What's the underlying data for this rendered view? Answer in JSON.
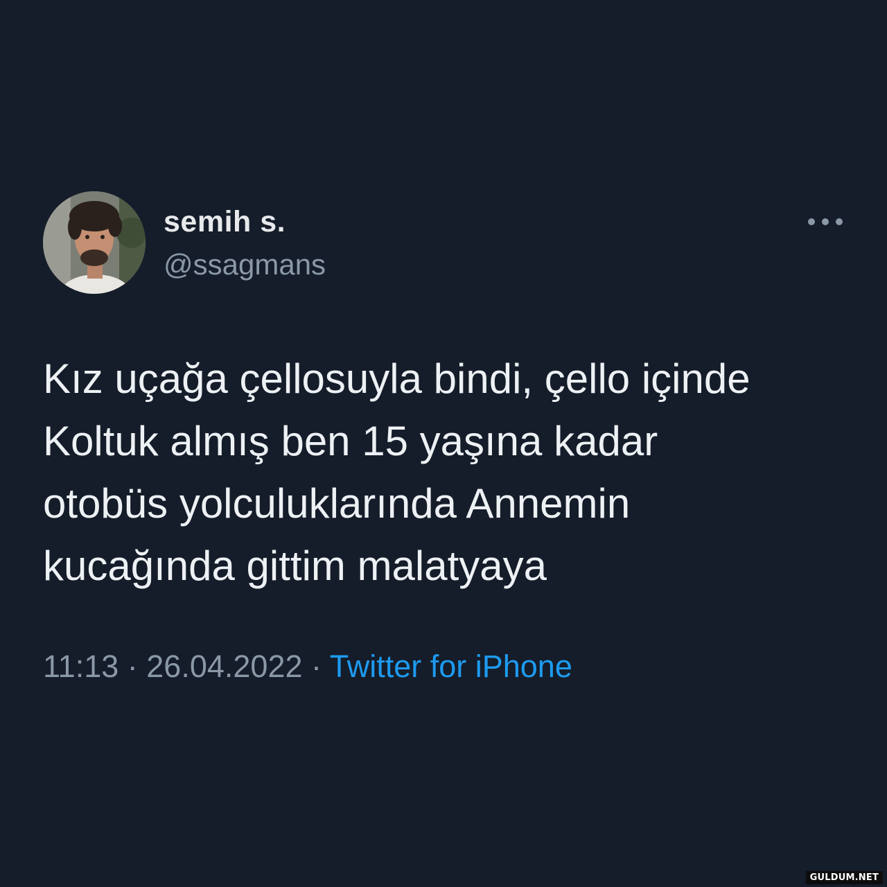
{
  "user": {
    "display_name": "semih s.",
    "handle": "@ssagmans"
  },
  "more_icon": "more-horizontal-icon",
  "tweet": {
    "lines": [
      "Kız uçağa çellosuyla bindi, çello içinde",
      "Koltuk almış ben 15 yaşına kadar",
      "otobüs yolculuklarında Annemin",
      "kucağında gittim malatyaya"
    ]
  },
  "meta": {
    "time": "11:13",
    "separator": " · ",
    "date": "26.04.2022",
    "source": "Twitter for iPhone"
  },
  "watermark": "GULDUM.NET",
  "colors": {
    "background": "#151d2a",
    "primary_text": "#e7e9ea",
    "secondary_text": "#8b98a5",
    "link": "#1d9bf0"
  }
}
